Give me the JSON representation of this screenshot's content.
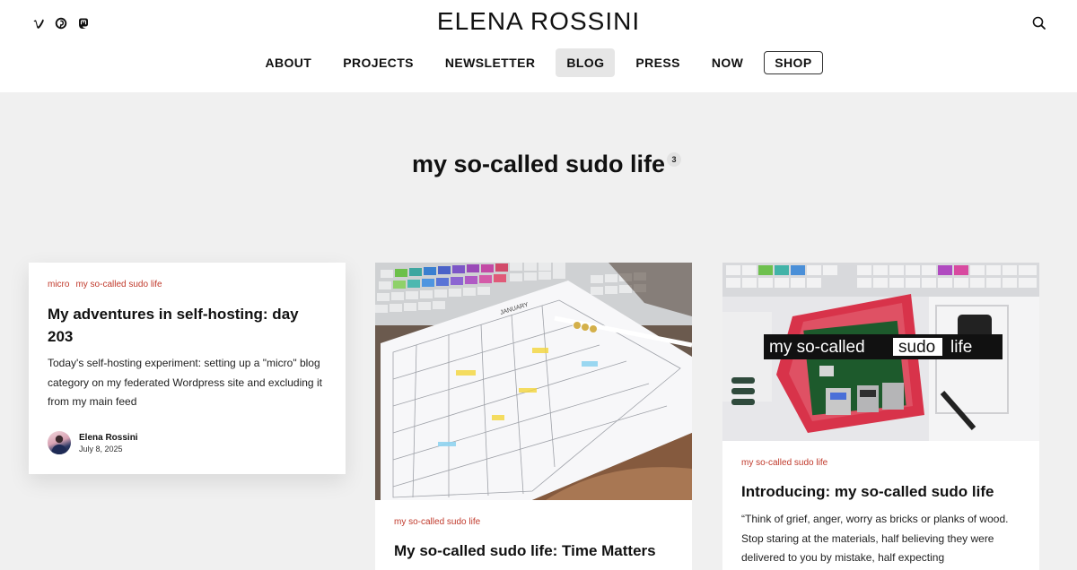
{
  "site": {
    "title": "ELENA ROSSINI"
  },
  "social": [
    "vimeo-icon",
    "pinterest-icon",
    "mastodon-icon"
  ],
  "nav": {
    "items": [
      {
        "label": "ABOUT"
      },
      {
        "label": "PROJECTS"
      },
      {
        "label": "NEWSLETTER"
      },
      {
        "label": "BLOG",
        "active": true
      },
      {
        "label": "PRESS"
      },
      {
        "label": "NOW"
      },
      {
        "label": "SHOP"
      }
    ]
  },
  "page": {
    "title": "my so-called sudo life",
    "count": "3"
  },
  "cards": [
    {
      "categories": [
        "micro",
        "my so-called sudo life"
      ],
      "title": "My adventures in self-hosting: day 203",
      "excerpt": "Today's self-hosting experiment: setting up a \"micro\" blog category on my federated Wordpress site and excluding it from my main feed",
      "author": "Elena Rossini",
      "date": "July 8, 2025"
    },
    {
      "image": "calendar-photo",
      "image_text": {
        "month": "JANUARY"
      },
      "categories": [
        "my so-called sudo life"
      ],
      "title": "My so-called sudo life: Time Matters"
    },
    {
      "image": "raspberry-pi-photo",
      "image_text": {
        "pre": "my so-called",
        "highlight": "sudo",
        "post": "life"
      },
      "categories": [
        "my so-called sudo life"
      ],
      "title": "Introducing: my so-called sudo life",
      "excerpt": "“Think of grief, anger, worry as bricks or planks of wood. Stop staring at the materials, half believing they were delivered to you by mistake, half expecting"
    }
  ],
  "colors": {
    "category": "#c0392b",
    "background": "#f0f0f0",
    "header": "#ffffff"
  }
}
